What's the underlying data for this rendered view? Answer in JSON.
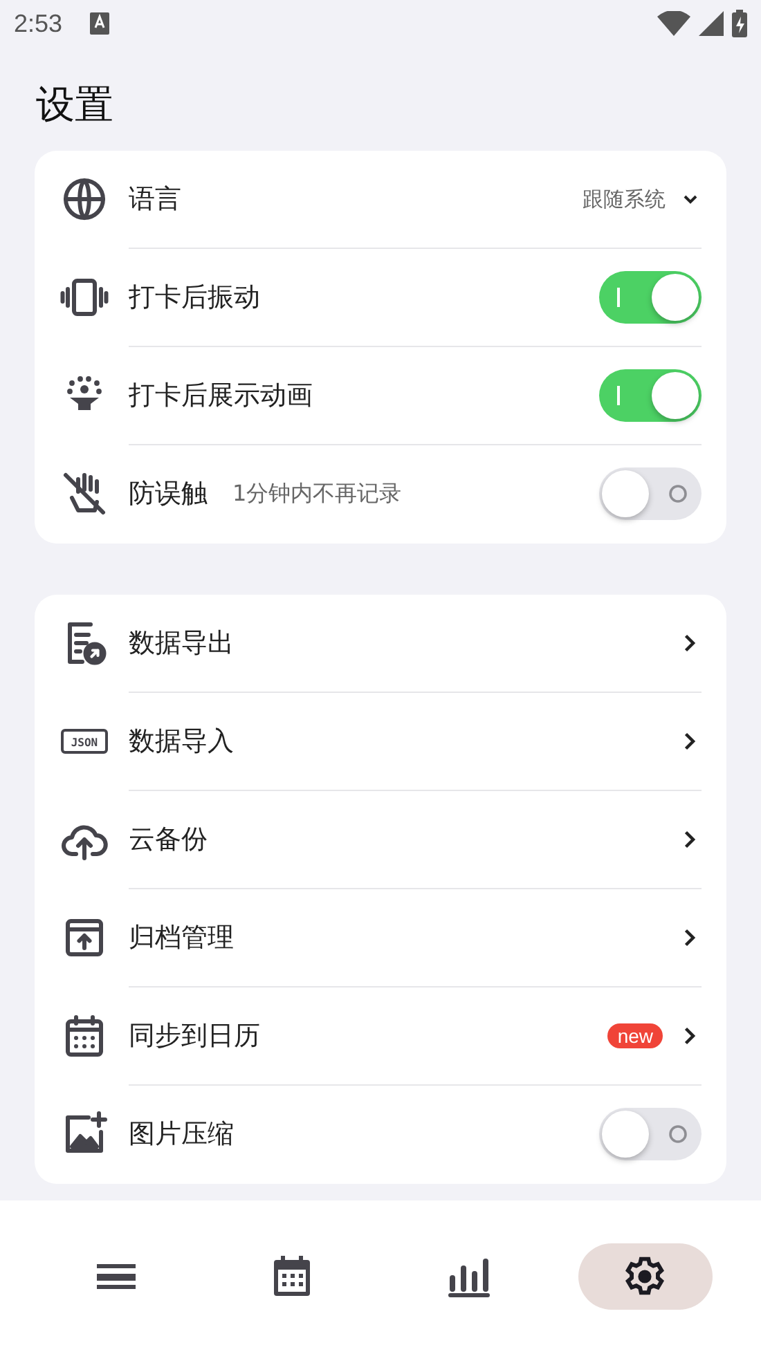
{
  "status_bar": {
    "time": "2:53"
  },
  "title": "设置",
  "groups": [
    {
      "items": [
        {
          "kind": "select",
          "label": "语言",
          "value": "跟随系统"
        },
        {
          "kind": "toggle",
          "label": "打卡后振动",
          "on": true
        },
        {
          "kind": "toggle",
          "label": "打卡后展示动画",
          "on": true
        },
        {
          "kind": "toggle",
          "label": "防误触",
          "hint": "1分钟内不再记录",
          "on": false
        }
      ]
    },
    {
      "items": [
        {
          "kind": "link",
          "label": "数据导出"
        },
        {
          "kind": "link",
          "label": "数据导入",
          "icon_text": "JSON"
        },
        {
          "kind": "link",
          "label": "云备份"
        },
        {
          "kind": "link",
          "label": "归档管理"
        },
        {
          "kind": "link",
          "label": "同步到日历",
          "badge": "new"
        },
        {
          "kind": "toggle",
          "label": "图片压缩",
          "on": false
        }
      ]
    }
  ],
  "nav": [
    {
      "selected": false
    },
    {
      "selected": false
    },
    {
      "selected": false
    },
    {
      "selected": true
    }
  ]
}
